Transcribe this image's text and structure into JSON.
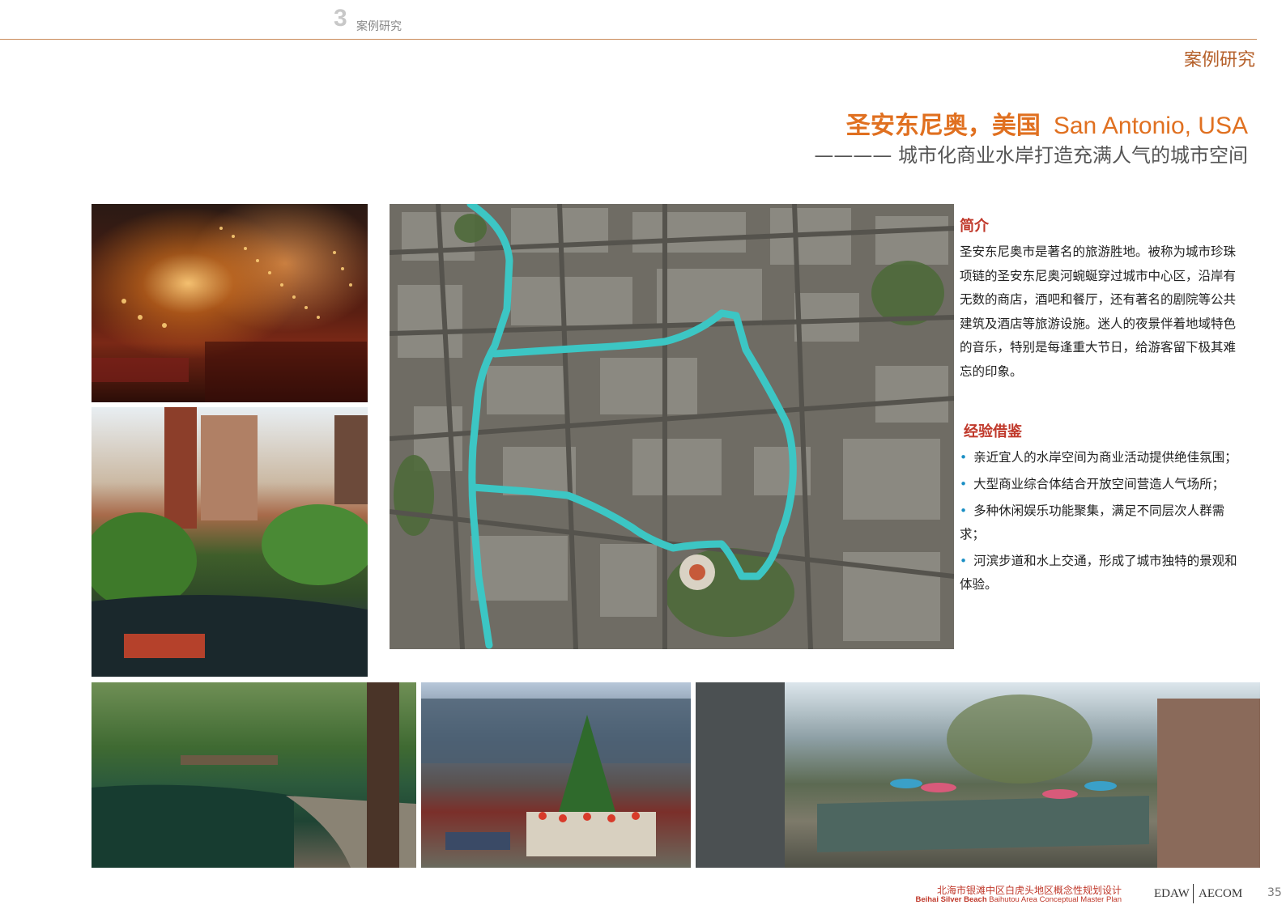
{
  "header": {
    "section_number": "3",
    "section_label": "案例研究",
    "right_label": "案例研究"
  },
  "title": {
    "cn": "圣安东尼奥，美国",
    "en": "San Antonio, USA",
    "subtitle": "———— 城市化商业水岸打造充满人气的城市空间"
  },
  "intro": {
    "heading": "简介",
    "text": "圣安东尼奥市是著名的旅游胜地。被称为城市珍珠项链的圣安东尼奥河蜿蜒穿过城市中心区，沿岸有无数的商店，酒吧和餐厅，还有著名的剧院等公共建筑及酒店等旅游设施。迷人的夜景伴着地域特色的音乐，特别是每逢重大节日，给游客留下极其难忘的印象。"
  },
  "experience": {
    "heading": "经验借鉴",
    "bullet": "•",
    "items": [
      "亲近宜人的水岸空间为商业活动提供绝佳氛围；",
      "大型商业综合体结合开放空间营造人气场所；",
      "多种休闲娱乐功能聚集，满足不同层次人群需求；",
      "河滨步道和水上交通，形成了城市独特的景观和体验。"
    ]
  },
  "map": {
    "route_color": "#3cc6c4"
  },
  "footer": {
    "cn": "北海市银滩中区白虎头地区概念性规划设计",
    "en_bold": "Beihai Silver Beach",
    "en_rest": "Baihutou Area Conceptual Master Plan",
    "logo_left": "EDAW",
    "logo_right": "AECOM",
    "page": "35"
  }
}
